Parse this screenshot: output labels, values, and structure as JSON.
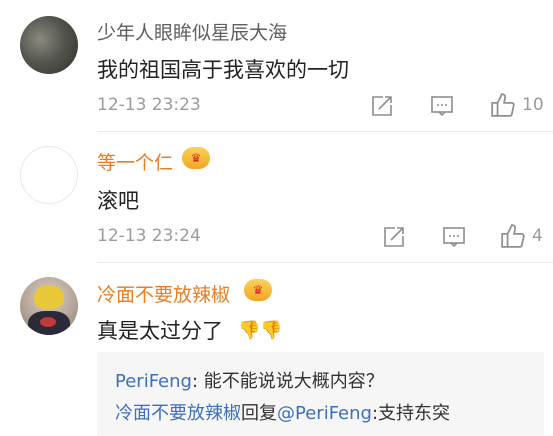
{
  "comments": [
    {
      "username": "少年人眼眸似星辰大海",
      "text": "我的祖国高于我喜欢的一切",
      "time": "12-13 23:23",
      "likes": "10"
    },
    {
      "username": "等一个仁",
      "text": "滚吧",
      "time": "12-13 23:24",
      "likes": "4"
    },
    {
      "username": "冷面不要放辣椒",
      "text": "真是太过分了",
      "emoji": "thumbs-down-emoji"
    }
  ],
  "replies": [
    {
      "user": "PeriFeng",
      "sep": ": ",
      "text": "能不能说说大概内容？"
    },
    {
      "user": "冷面不要放辣椒",
      "verb": "回复",
      "mention": "@PeriFeng",
      "sep": ":",
      "text": "支持东突"
    }
  ],
  "colors": {
    "username": "#ea7d20",
    "link": "#3d6fbf",
    "muted": "#9b9b9b"
  },
  "icons": [
    "share-icon",
    "comment-icon",
    "like-icon",
    "vip-badge-icon"
  ]
}
